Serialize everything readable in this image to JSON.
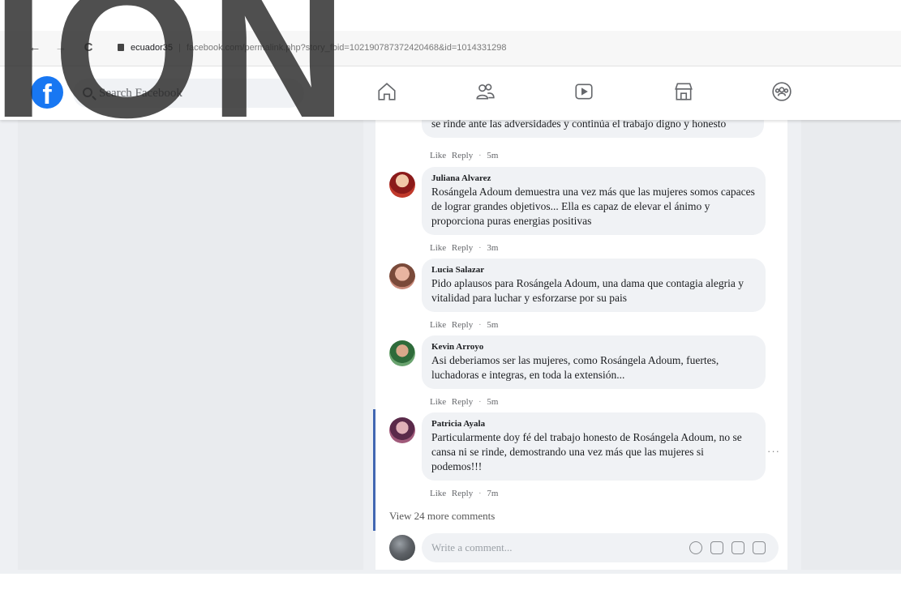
{
  "browser": {
    "back": "←",
    "forward": "→",
    "reload": "C",
    "url_domain": "ecuador35",
    "url_separator": "|",
    "url_path": "facebook.com/permalink.php?story_fbid=102190787372420468&id=1014331298"
  },
  "fb": {
    "logo": "f",
    "search_placeholder": "Search Facebook",
    "nav_icons": [
      "home-icon",
      "friends-icon",
      "watch-icon",
      "marketplace-icon",
      "groups-icon"
    ]
  },
  "comments": [
    {
      "author": "",
      "text": "se rinde ante las adversidades y continúa el trabajo digno y honesto",
      "like": "Like",
      "reply": "Reply",
      "time": "5m"
    },
    {
      "author": "Juliana Alvarez",
      "text": "Rosángela Adoum demuestra una vez más que las mujeres somos capaces de lograr grandes objetivos... Ella es capaz de elevar el ánimo y proporciona puras energias positivas",
      "like": "Like",
      "reply": "Reply",
      "time": "3m"
    },
    {
      "author": "Lucia Salazar",
      "text": "Pido aplausos para Rosángela Adoum, una dama que contagia alegria y vitalidad para luchar y esforzarse por su pais",
      "like": "Like",
      "reply": "Reply",
      "time": "5m"
    },
    {
      "author": "Kevin Arroyo",
      "text": "Asi deberiamos ser las mujeres, como Rosángela Adoum, fuertes, luchadoras e integras, en toda la extensión...",
      "like": "Like",
      "reply": "Reply",
      "time": "5m"
    },
    {
      "author": "Patricia Ayala",
      "text": "Particularmente doy fé del trabajo honesto de Rosángela Adoum, no se cansa ni se rinde, demostrando una vez más que las mujeres si podemos!!!",
      "like": "Like",
      "reply": "Reply",
      "time": "7m"
    }
  ],
  "more_options": "···",
  "view_more": "View 24 more comments",
  "composer": {
    "placeholder": "Write a comment...",
    "icons": [
      "emoji-icon",
      "camera-icon",
      "gif-icon",
      "sticker-icon"
    ]
  },
  "watermark": "ION",
  "colors": {
    "fb_blue": "#1877f2",
    "thread_line": "#4267b2",
    "bubble": "#f0f2f5"
  }
}
